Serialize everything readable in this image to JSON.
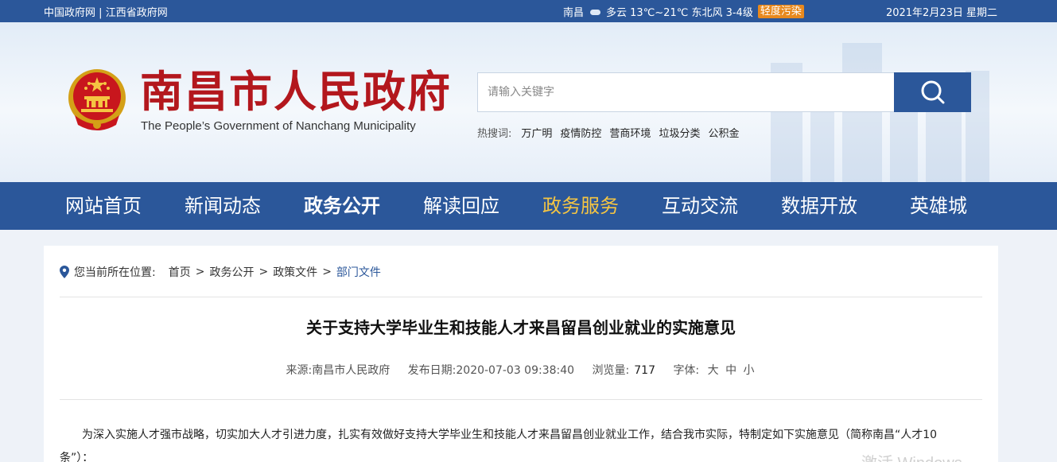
{
  "topbar": {
    "link1": "中国政府网",
    "separator": "|",
    "link2": "江西省政府网",
    "city": "南昌",
    "weather_icon": "cloud-icon",
    "weather": "多云 13℃~21℃ 东北风 3-4级",
    "air_quality": "轻度污染",
    "date": "2021年2月23日 星期二"
  },
  "header": {
    "title": "南昌市人民政府",
    "subtitle": "The People’s Government of Nanchang Municipality",
    "search_placeholder": "请输入关键字",
    "hot_label": "热搜词:",
    "hot_words": [
      "万广明",
      "疫情防控",
      "营商环境",
      "垃圾分类",
      "公积金"
    ]
  },
  "nav": {
    "items": [
      "网站首页",
      "新闻动态",
      "政务公开",
      "解读回应",
      "政务服务",
      "互动交流",
      "数据开放",
      "英雄城"
    ],
    "bold_item": "政务公开",
    "active_item": "政务服务"
  },
  "breadcrumb": {
    "label": "您当前所在位置:",
    "items": [
      "首页",
      "政务公开",
      "政策文件",
      "部门文件"
    ],
    "sep": ">"
  },
  "article": {
    "title": "关于支持大学毕业生和技能人才来昌留昌创业就业的实施意见",
    "source_label": "来源:",
    "source": "南昌市人民政府",
    "date_label": "发布日期:",
    "date": "2020-07-03 09:38:40",
    "views_label": "浏览量:",
    "views": "717",
    "font_label": "字体:",
    "font_large": "大",
    "font_medium": "中",
    "font_small": "小",
    "body": "为深入实施人才强市战略，切实加大人才引进力度，扎实有效做好支持大学毕业生和技能人才来昌留昌创业就业工作，结合我市实际，特制定如下实施意见（简称南昌“人才10条”）："
  },
  "watermark": "激活 Windows",
  "colors": {
    "brand_blue": "#2b579a",
    "title_red": "#b3171d",
    "nav_active": "#f5c542",
    "badge_orange": "#e8891e"
  }
}
